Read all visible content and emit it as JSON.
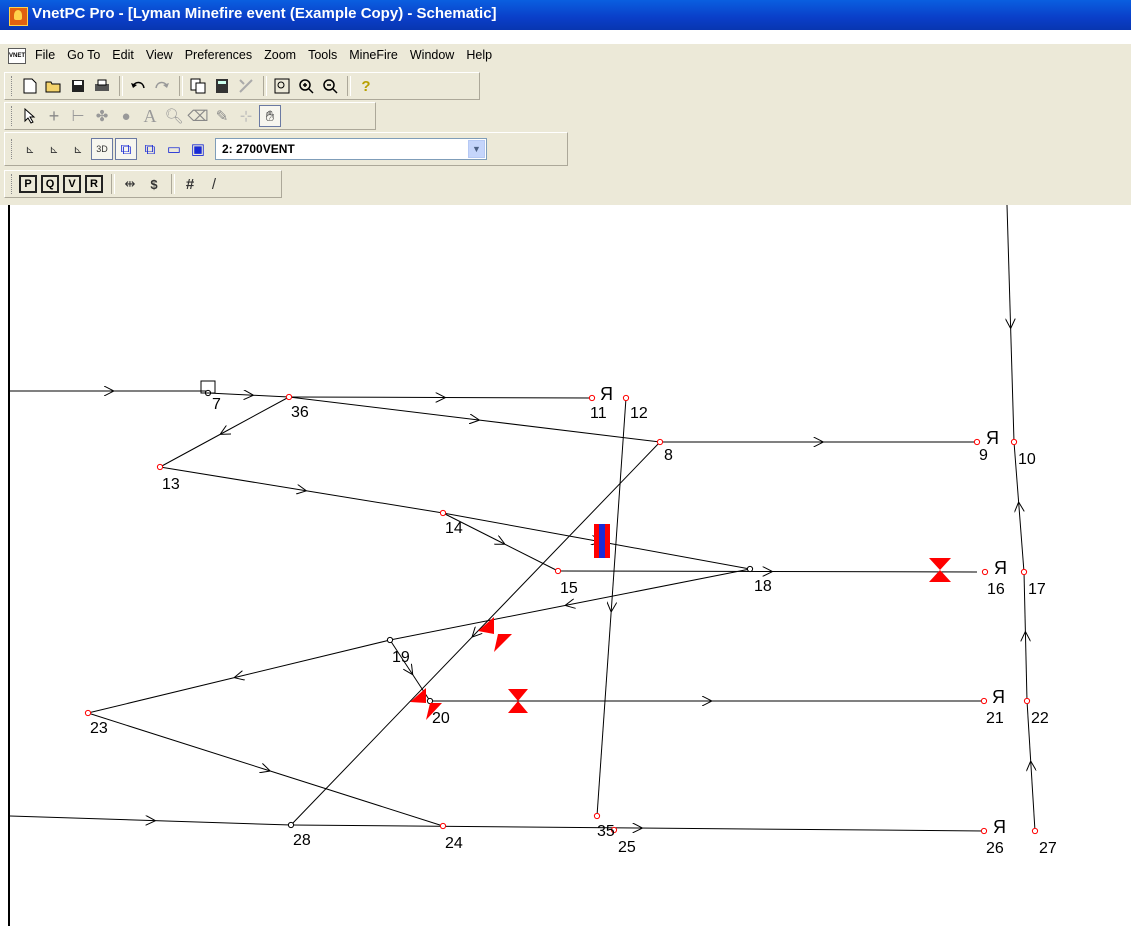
{
  "window": {
    "title": "VnetPC Pro - [Lyman Minefire event (Example Copy) - Schematic]"
  },
  "menu": {
    "doc_icon": "VNET",
    "items": [
      "File",
      "Go To",
      "Edit",
      "View",
      "Preferences",
      "Zoom",
      "Tools",
      "MineFire",
      "Window",
      "Help"
    ]
  },
  "toolbar": {
    "row1": [
      "new-file-icon",
      "open-folder-icon",
      "save-icon",
      "print-icon",
      "undo-icon",
      "redo-icon",
      "copy-icon",
      "calculator-icon",
      "network-check-icon",
      "zoom-fit-icon",
      "zoom-in-icon",
      "zoom-out-icon",
      "help-icon"
    ],
    "row2": [
      "pointer-icon",
      "add-junction-icon",
      "add-branch-icon",
      "add-fan-icon",
      "add-fire-icon",
      "add-text-icon",
      "find-icon",
      "erase-icon",
      "edit-icon",
      "move-icon",
      "pan-hand-icon"
    ],
    "row3": {
      "layer_value": "2: 2700VENT"
    },
    "row4": [
      "P",
      "Q",
      "V",
      "R"
    ]
  },
  "schematic": {
    "nodes": [
      {
        "id": "7",
        "label": "7"
      },
      {
        "id": "36",
        "label": "36"
      },
      {
        "id": "11",
        "label": "11"
      },
      {
        "id": "12",
        "label": "12"
      },
      {
        "id": "13",
        "label": "13"
      },
      {
        "id": "8",
        "label": "8"
      },
      {
        "id": "9",
        "label": "9"
      },
      {
        "id": "10",
        "label": "10"
      },
      {
        "id": "14",
        "label": "14"
      },
      {
        "id": "15",
        "label": "15"
      },
      {
        "id": "18",
        "label": "18"
      },
      {
        "id": "16",
        "label": "16"
      },
      {
        "id": "17",
        "label": "17"
      },
      {
        "id": "19",
        "label": "19"
      },
      {
        "id": "20",
        "label": "20"
      },
      {
        "id": "21",
        "label": "21"
      },
      {
        "id": "22",
        "label": "22"
      },
      {
        "id": "23",
        "label": "23"
      },
      {
        "id": "28",
        "label": "28"
      },
      {
        "id": "24",
        "label": "24"
      },
      {
        "id": "35",
        "label": "35"
      },
      {
        "id": "25",
        "label": "25"
      },
      {
        "id": "26",
        "label": "26"
      },
      {
        "id": "27",
        "label": "27"
      }
    ]
  },
  "colors": {
    "title_bar": "#0a3ec8",
    "regulator": "#ff0000",
    "fan_blue": "#1a2bd6"
  }
}
